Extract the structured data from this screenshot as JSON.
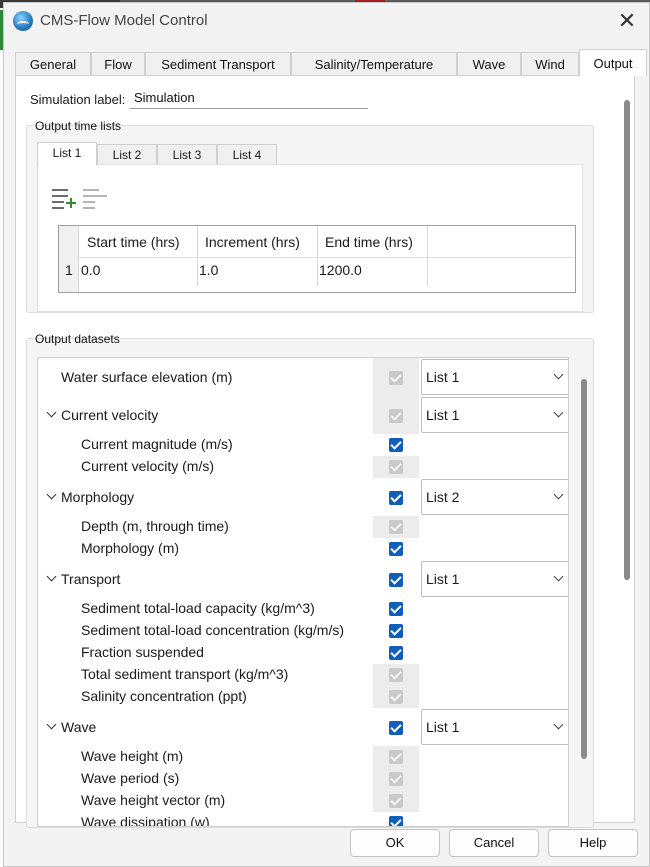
{
  "window": {
    "title": "CMS-Flow Model Control",
    "icon": "app-globe-icon",
    "close_icon": "close-icon",
    "close_glyph": "✕"
  },
  "tabs": [
    "General",
    "Flow",
    "Sediment Transport",
    "Salinity/Temperature",
    "Wave",
    "Wind",
    "Output"
  ],
  "active_tab": "Output",
  "simulation": {
    "label": "Simulation label:",
    "value": "Simulation"
  },
  "output_time_lists": {
    "title": "Output time lists",
    "subtabs": [
      "List 1",
      "List 2",
      "List 3",
      "List 4"
    ],
    "active_subtab": "List 1",
    "toolbar": [
      {
        "name": "add-row-icon",
        "enabled": true
      },
      {
        "name": "remove-row-icon",
        "enabled": false
      }
    ],
    "columns": [
      "Start time (hrs)",
      "Increment (hrs)",
      "End time (hrs)"
    ],
    "rows": [
      {
        "index": "1",
        "cells": [
          "0.0",
          "1.0",
          "1200.0"
        ]
      }
    ]
  },
  "output_datasets": {
    "title": "Output datasets",
    "rows": [
      {
        "label": "Water surface elevation (m)",
        "level": 0,
        "expandable": false,
        "checked": true,
        "enabled": false,
        "list": "List 1"
      },
      {
        "label": "Current velocity",
        "level": 0,
        "expandable": true,
        "checked": true,
        "enabled": false,
        "list": "List 1"
      },
      {
        "label": "Current magnitude (m/s)",
        "level": 1,
        "checked": true,
        "enabled": true
      },
      {
        "label": "Current velocity (m/s)",
        "level": 1,
        "checked": true,
        "enabled": false
      },
      {
        "label": "Morphology",
        "level": 0,
        "expandable": true,
        "checked": true,
        "enabled": true,
        "list": "List 2"
      },
      {
        "label": "Depth (m, through time)",
        "level": 1,
        "checked": true,
        "enabled": false
      },
      {
        "label": "Morphology (m)",
        "level": 1,
        "checked": true,
        "enabled": true
      },
      {
        "label": "Transport",
        "level": 0,
        "expandable": true,
        "checked": true,
        "enabled": true,
        "list": "List 1"
      },
      {
        "label": "Sediment total-load capacity (kg/m^3)",
        "level": 1,
        "checked": true,
        "enabled": true
      },
      {
        "label": "Sediment total-load concentration (kg/m/s)",
        "level": 1,
        "checked": true,
        "enabled": true
      },
      {
        "label": "Fraction suspended",
        "level": 1,
        "checked": true,
        "enabled": true
      },
      {
        "label": "Total sediment transport (kg/m^3)",
        "level": 1,
        "checked": true,
        "enabled": false
      },
      {
        "label": "Salinity concentration (ppt)",
        "level": 1,
        "checked": true,
        "enabled": false
      },
      {
        "label": "Wave",
        "level": 0,
        "expandable": true,
        "checked": true,
        "enabled": true,
        "list": "List 1"
      },
      {
        "label": "Wave height (m)",
        "level": 1,
        "checked": true,
        "enabled": false
      },
      {
        "label": "Wave period (s)",
        "level": 1,
        "checked": true,
        "enabled": false
      },
      {
        "label": "Wave height vector (m)",
        "level": 1,
        "checked": true,
        "enabled": false
      },
      {
        "label": "Wave dissipation (w)",
        "level": 1,
        "checked": true,
        "enabled": true
      }
    ]
  },
  "buttons": {
    "ok": "OK",
    "cancel": "Cancel",
    "help": "Help"
  }
}
